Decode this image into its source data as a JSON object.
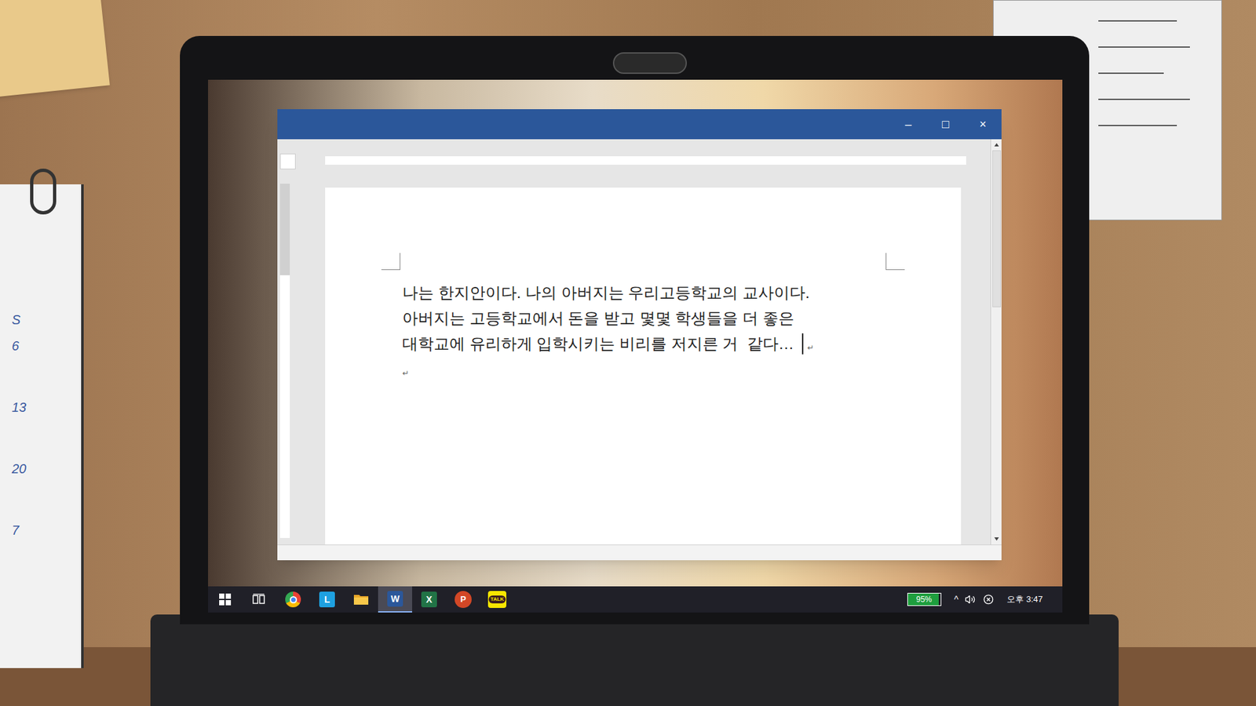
{
  "calendar": {
    "labels": [
      "S",
      "6",
      "13",
      "20",
      "7"
    ]
  },
  "window": {
    "controls": [
      "–",
      "□",
      "×"
    ]
  },
  "document": {
    "lines": [
      {
        "text": "나는 한지안이다. 나의 아버지는 우리고등학교의 교사이다.",
        "mark": "",
        "cursor": false
      },
      {
        "text": "아버지는 고등학교에서 돈을 받고 몇몇 학생들을 더 좋은",
        "mark": "",
        "cursor": false
      },
      {
        "text": "대학교에 유리하게 입학시키는 비리를 저지른 거  같다…",
        "mark": "↵",
        "cursor": true
      },
      {
        "text": "",
        "mark": "↵",
        "cursor": false
      }
    ]
  },
  "taskbar": {
    "apps": [
      {
        "kind": "start",
        "glyph": "",
        "selected": false
      },
      {
        "kind": "taskview",
        "glyph": "",
        "selected": false
      },
      {
        "kind": "chrome",
        "glyph": "",
        "selected": false
      },
      {
        "kind": "tile",
        "glyph": "L",
        "color": "#1ea0e0",
        "selected": false
      },
      {
        "kind": "folder",
        "glyph": "",
        "selected": false
      },
      {
        "kind": "tile",
        "glyph": "W",
        "color": "#2b579a",
        "selected": true
      },
      {
        "kind": "tile",
        "glyph": "X",
        "color": "#217346",
        "selected": false
      },
      {
        "kind": "round",
        "glyph": "P",
        "color": "#d24726",
        "selected": false
      },
      {
        "kind": "talk",
        "glyph": "TALK",
        "color": "#f7e600",
        "selected": false
      }
    ],
    "battery": {
      "label": "95%",
      "level": 0.95
    },
    "chevron": "^",
    "time": "오후 3:47"
  }
}
